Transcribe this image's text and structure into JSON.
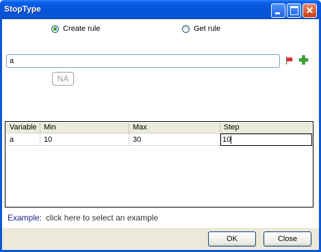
{
  "window": {
    "title": "StopType"
  },
  "radios": {
    "create_rule": {
      "label": "Create rule",
      "selected": true
    },
    "get_rule": {
      "label": "Get rule",
      "selected": false
    }
  },
  "rule_input": {
    "value": "a"
  },
  "na_button": {
    "label": "NA"
  },
  "icons": {
    "flag": "red-flag-icon",
    "add": "green-plus-icon"
  },
  "grid": {
    "columns": [
      "Variable",
      "Min",
      "Max",
      "Step"
    ],
    "rows": [
      {
        "variable": "a",
        "min": "10",
        "max": "30",
        "step": "10"
      }
    ]
  },
  "example": {
    "label": "Example:",
    "link": "click here to select an example"
  },
  "buttons": {
    "ok": "OK",
    "close": "Close"
  },
  "colors": {
    "titlebar": "#0754db",
    "accent_green": "#21a121",
    "example_label": "#1c1c8c"
  }
}
